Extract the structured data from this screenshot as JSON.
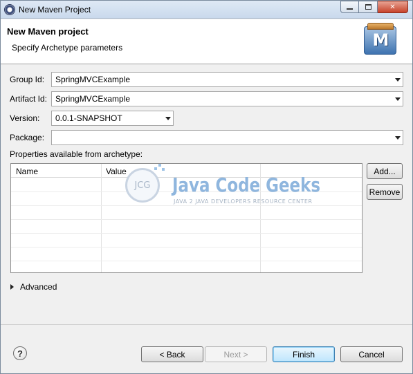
{
  "window": {
    "title": "New Maven Project"
  },
  "header": {
    "title": "New Maven project",
    "subtitle": "Specify Archetype parameters",
    "logo_letter": "M"
  },
  "form": {
    "group_id": {
      "label": "Group Id:",
      "value": "SpringMVCExample"
    },
    "artifact_id": {
      "label": "Artifact Id:",
      "value": "SpringMVCExample"
    },
    "version": {
      "label": "Version:",
      "value": "0.0.1-SNAPSHOT"
    },
    "package": {
      "label": "Package:",
      "value": ""
    }
  },
  "properties": {
    "label": "Properties available from archetype:",
    "columns": [
      "Name",
      "Value"
    ],
    "add_label": "Add...",
    "remove_label": "Remove"
  },
  "watermark": {
    "circle_text": "JCG",
    "title": "Java Code Geeks",
    "subtitle": "JAVA 2 JAVA DEVELOPERS RESOURCE CENTER"
  },
  "advanced": {
    "label": "Advanced"
  },
  "footer": {
    "help_label": "?",
    "back_label": "< Back",
    "next_label": "Next >",
    "finish_label": "Finish",
    "cancel_label": "Cancel"
  },
  "colors": {
    "accent": "#3c7fb1",
    "watermark_blue": "#8fb6de"
  }
}
